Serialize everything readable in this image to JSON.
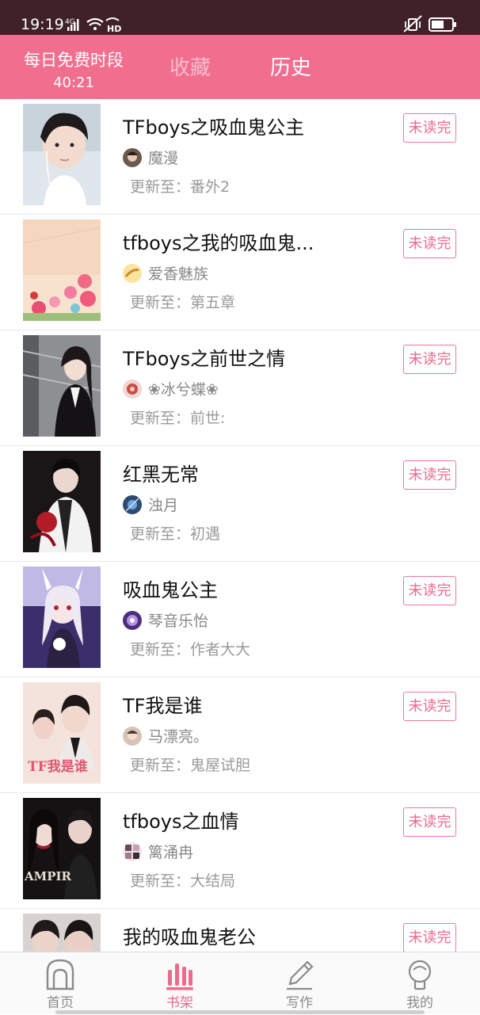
{
  "status_bar": {
    "time": "19:19",
    "network": "4G",
    "hd": "HD"
  },
  "header": {
    "free_label": "每日免费时段",
    "free_timer": "40:21",
    "tabs": [
      {
        "label": "收藏",
        "active": false
      },
      {
        "label": "历史",
        "active": true
      }
    ]
  },
  "books": [
    {
      "title": "TFboys之吸血鬼公主",
      "author": "魔漫",
      "update": "更新至：番外2",
      "badge": "未读完"
    },
    {
      "title": "tfboys之我的吸血鬼...",
      "author": "爱香魅族",
      "update": "更新至：第五章",
      "badge": "未读完"
    },
    {
      "title": "TFboys之前世之情",
      "author": "❀冰兮蝶❀",
      "update": "更新至：前世:",
      "badge": "未读完"
    },
    {
      "title": "红黑无常",
      "author": "浊月",
      "update": "更新至：初遇",
      "badge": "未读完"
    },
    {
      "title": "吸血鬼公主",
      "author": "琴音乐怡",
      "update": "更新至：作者大大",
      "badge": "未读完"
    },
    {
      "title": "TF我是谁",
      "author": "马漂亮。",
      "update": "更新至：鬼屋试胆",
      "badge": "未读完",
      "cover_text": "TF我是谁"
    },
    {
      "title": "tfboys之血情",
      "author": "篱涌冉",
      "update": "更新至：大结局",
      "badge": "未读完",
      "cover_text": "AMPIR"
    },
    {
      "title": "我的吸血鬼老公",
      "author": "",
      "update": "",
      "badge": "未读完"
    }
  ],
  "bottom_nav": [
    {
      "label": "首页",
      "icon": "home-icon",
      "active": false
    },
    {
      "label": "书架",
      "icon": "bookshelf-icon",
      "active": true
    },
    {
      "label": "写作",
      "icon": "pencil-icon",
      "active": false
    },
    {
      "label": "我的",
      "icon": "profile-icon",
      "active": false
    }
  ],
  "colors": {
    "accent": "#f16e8f",
    "badge": "#ee6a8c",
    "status_bar": "#40212a"
  }
}
